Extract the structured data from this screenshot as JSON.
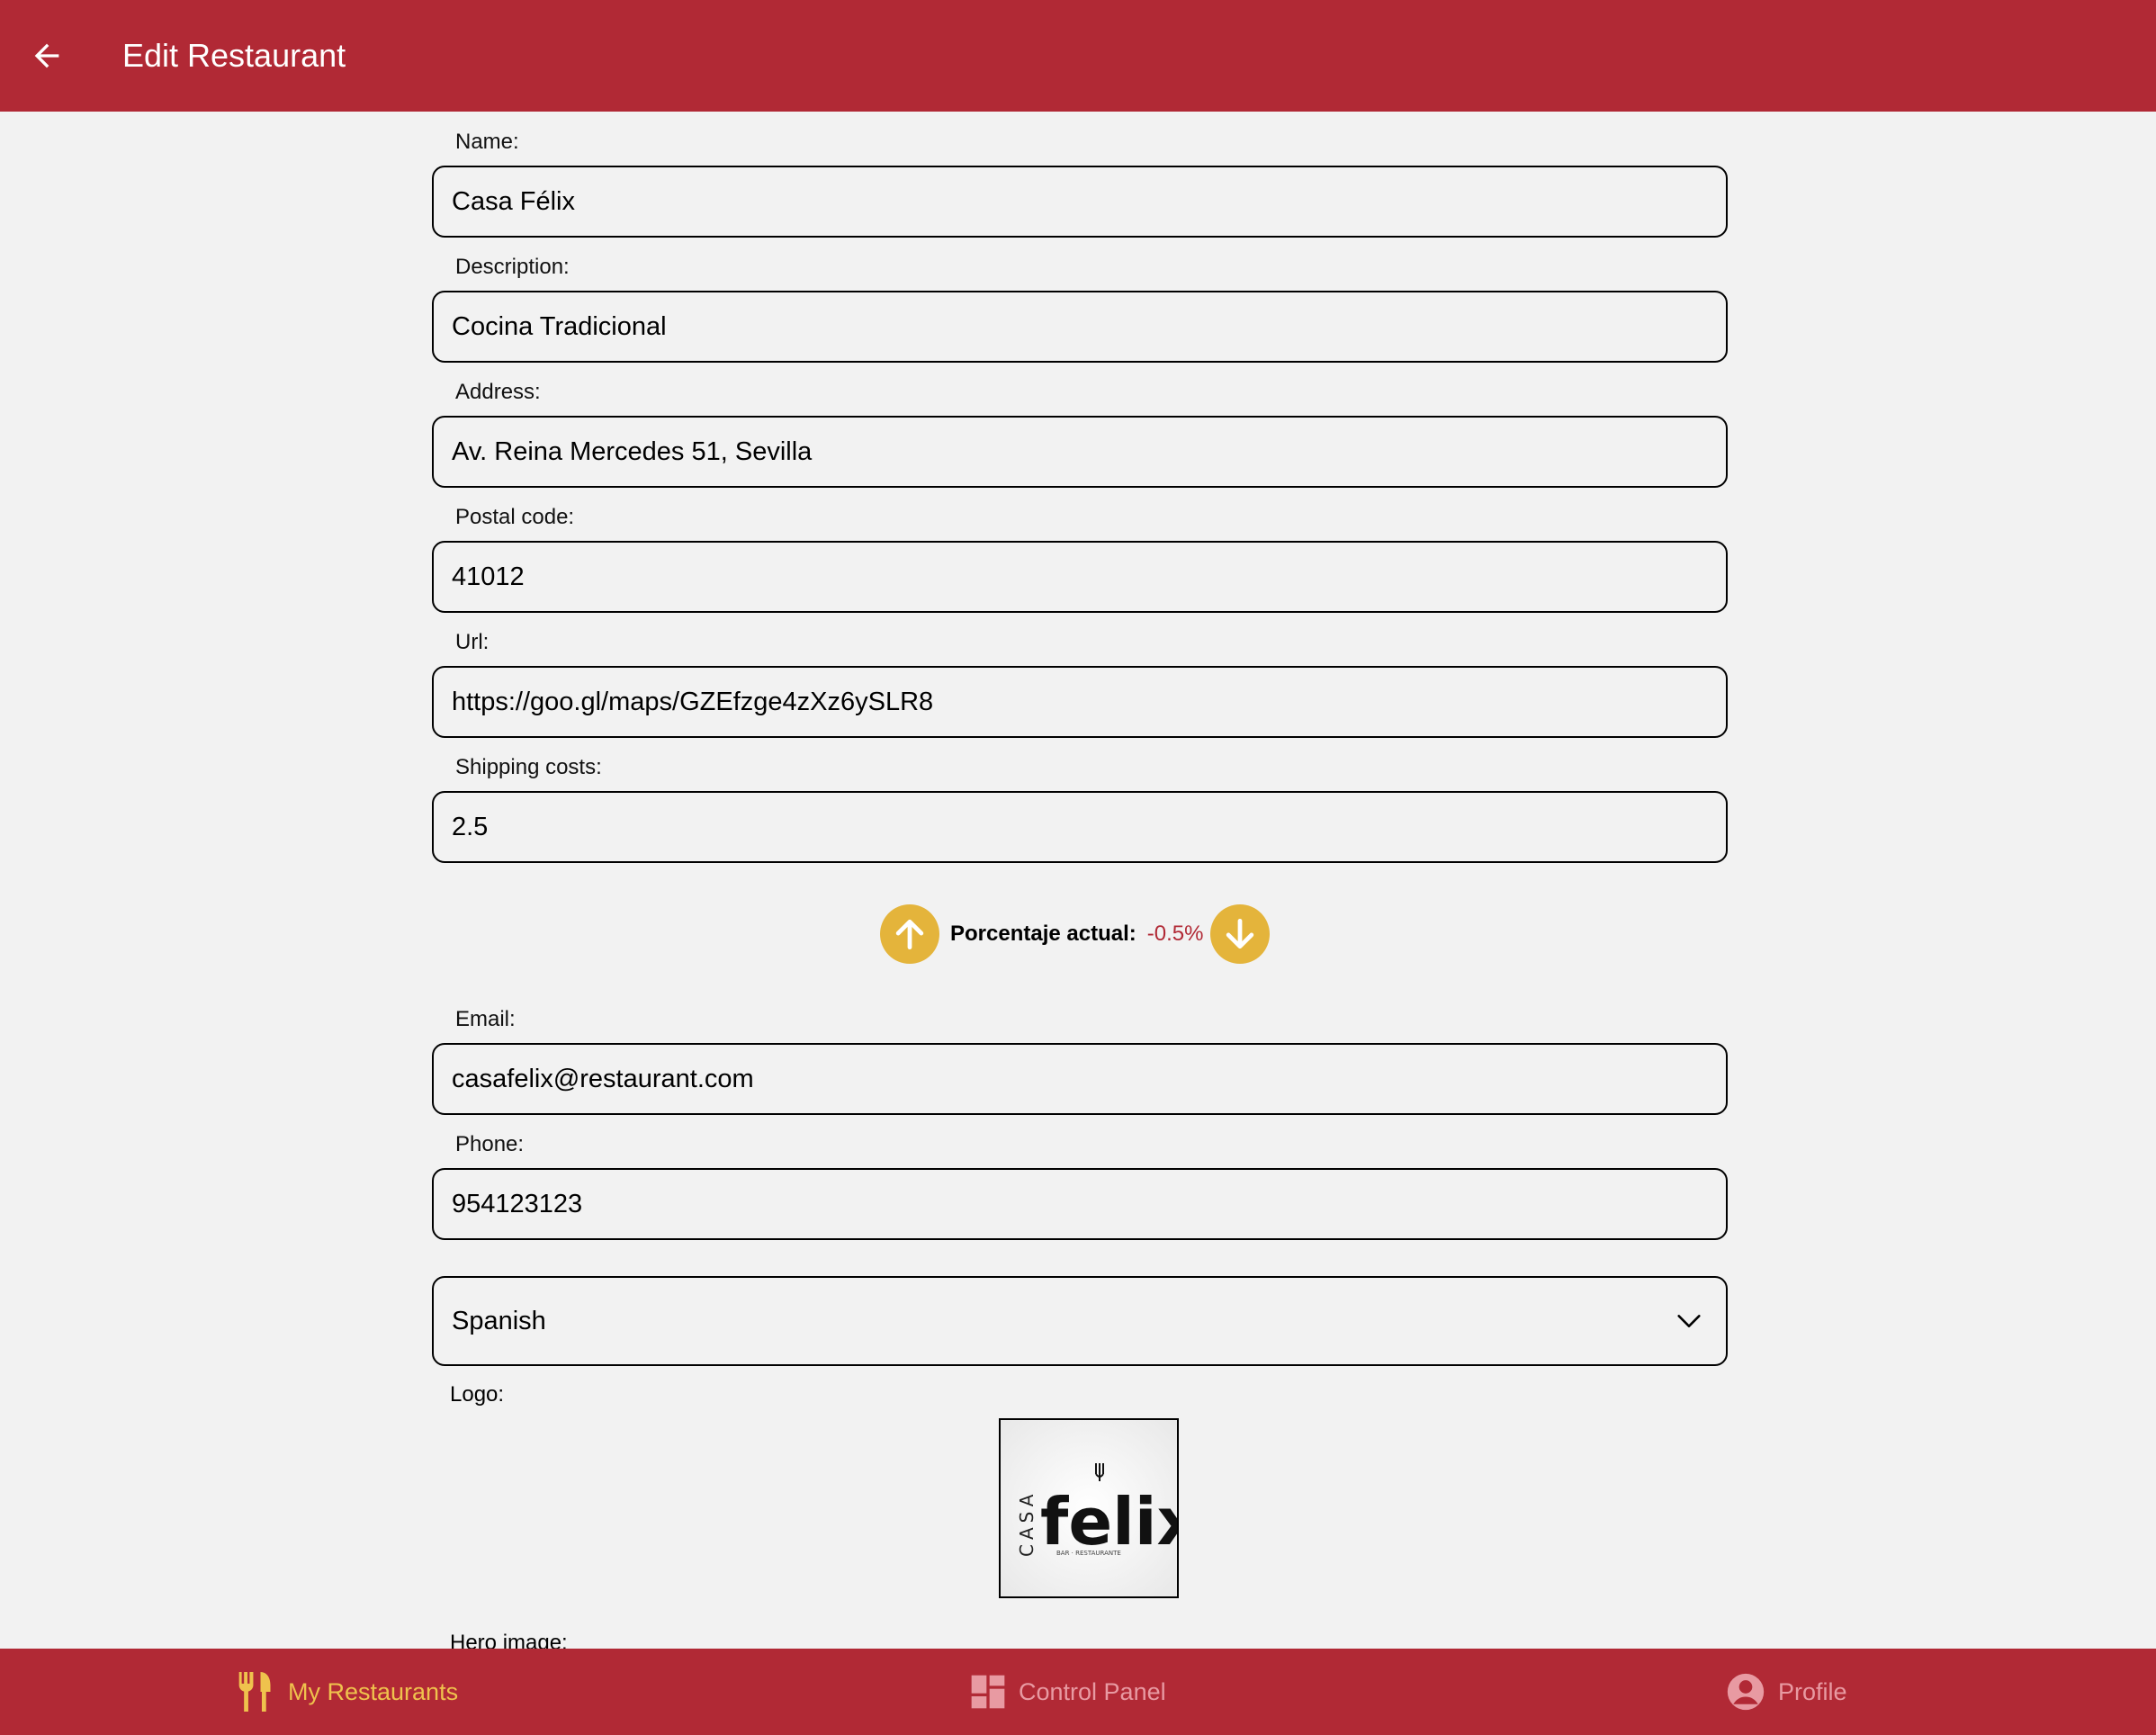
{
  "header": {
    "title": "Edit Restaurant"
  },
  "form": {
    "name": {
      "label": "Name:",
      "value": "Casa Félix"
    },
    "description": {
      "label": "Description:",
      "value": "Cocina Tradicional"
    },
    "address": {
      "label": "Address:",
      "value": "Av. Reina Mercedes 51, Sevilla"
    },
    "postal_code": {
      "label": "Postal code:",
      "value": "41012"
    },
    "url": {
      "label": "Url:",
      "value": "https://goo.gl/maps/GZEfzge4zXz6ySLR8"
    },
    "shipping_costs": {
      "label": "Shipping costs:",
      "value": "2.5"
    },
    "percentage": {
      "label": "Porcentaje actual:",
      "value": "-0.5%"
    },
    "email": {
      "label": "Email:",
      "value": "casafelix@restaurant.com"
    },
    "phone": {
      "label": "Phone:",
      "value": "954123123"
    },
    "category": {
      "selected": "Spanish"
    },
    "logo": {
      "label": "Logo:",
      "logo_text": "felix",
      "logo_side_text": "CASA",
      "logo_sub_text": "BAR · RESTAURANTE"
    },
    "hero_image": {
      "label": "Hero image:"
    }
  },
  "bottom_nav": {
    "items": [
      {
        "label": "My Restaurants",
        "icon": "fork-knife-icon",
        "active": true
      },
      {
        "label": "Control Panel",
        "icon": "dashboard-icon",
        "active": false
      },
      {
        "label": "Profile",
        "icon": "profile-icon",
        "active": false
      }
    ]
  },
  "colors": {
    "primary": "#b12935",
    "accent": "#e4b43b",
    "background": "#f2f2f2"
  }
}
